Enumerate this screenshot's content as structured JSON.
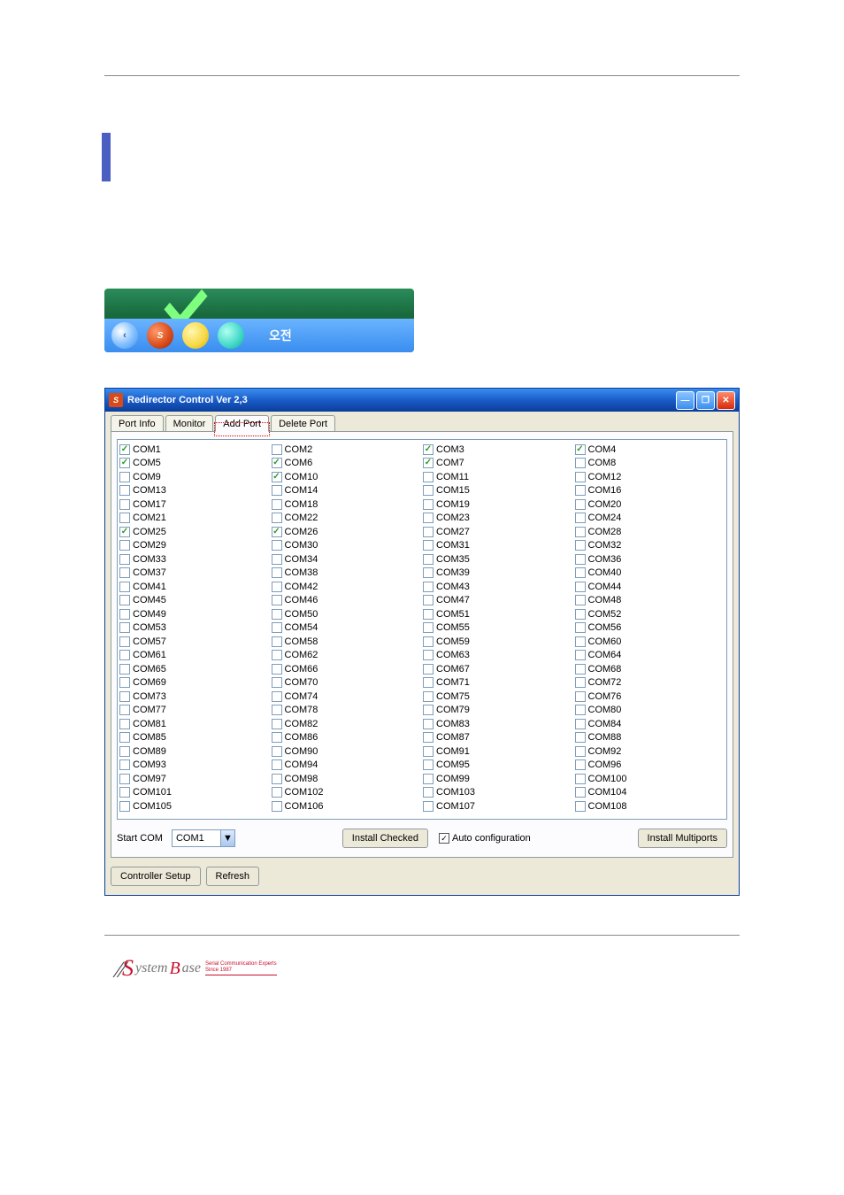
{
  "window": {
    "title": "Redirector Control Ver 2,3",
    "tabs": [
      "Port Info",
      "Monitor",
      "Add Port",
      "Delete Port"
    ],
    "active_tab": 2
  },
  "com_ports": {
    "checked": [
      1,
      3,
      4,
      5,
      6,
      7,
      10,
      25,
      26
    ],
    "range_start": 1,
    "range_end": 108
  },
  "controls": {
    "start_com_label": "Start COM",
    "start_com_value": "COM1",
    "install_checked": "Install Checked",
    "auto_cfg_label": "Auto configuration",
    "auto_cfg_checked": true,
    "install_multiports": "Install Multiports",
    "controller_setup": "Controller Setup",
    "refresh": "Refresh"
  },
  "taskbar": {
    "text": "오전"
  },
  "logo": {
    "brand1": "S",
    "brand2": "ystem",
    "brand3": "B",
    "brand4": "ase",
    "tag1": "Serial Communication Experts",
    "tag2": "Since 1987"
  }
}
